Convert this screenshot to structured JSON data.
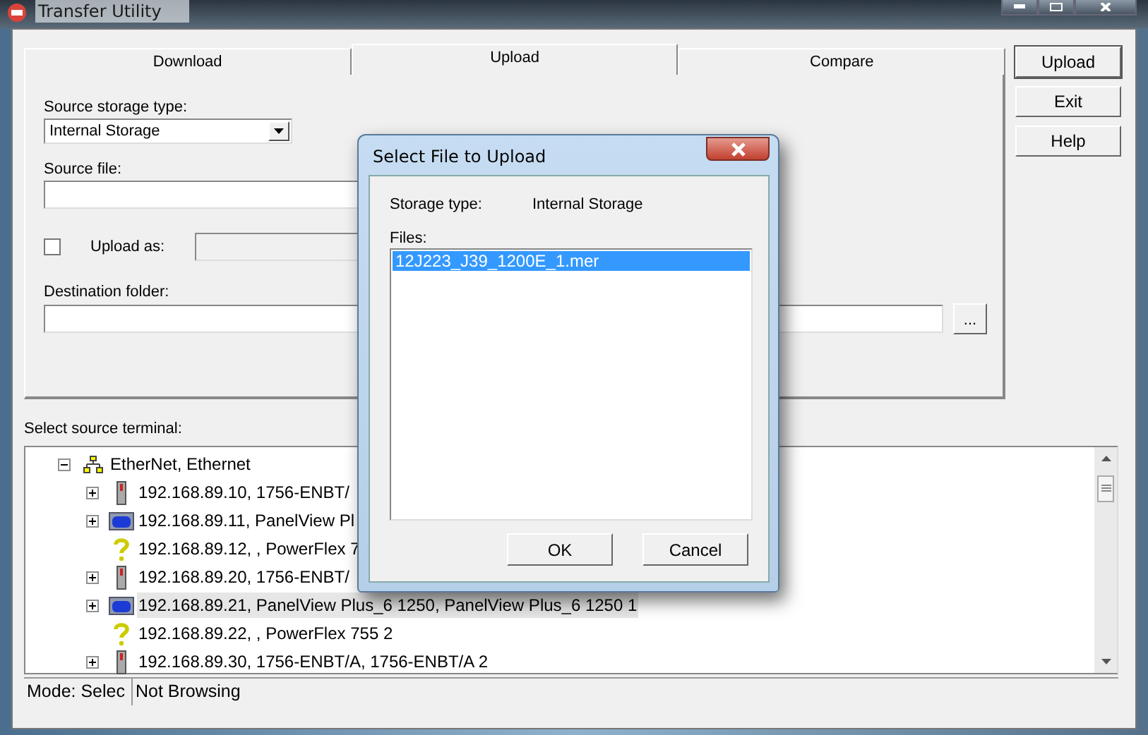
{
  "window": {
    "title": "Transfer Utility"
  },
  "tabs": [
    {
      "label": "Download",
      "selected": false
    },
    {
      "label": "Upload",
      "selected": true
    },
    {
      "label": "Compare",
      "selected": false
    }
  ],
  "upload_panel": {
    "source_storage_label": "Source storage type:",
    "source_storage_value": "Internal Storage",
    "source_file_label": "Source file:",
    "upload_as_checked": false,
    "upload_as_label": "Upload as:",
    "destination_label": "Destination folder:",
    "browse_button": "..."
  },
  "side_buttons": [
    "Upload",
    "Exit",
    "Help"
  ],
  "terminal_label": "Select source terminal:",
  "tree": [
    {
      "label": "EtherNet, Ethernet",
      "kind": "network",
      "expanded": true,
      "selected": false,
      "children": [
        {
          "label": "192.168.89.10, 1756-ENBT/",
          "kind": "module",
          "expanded": false,
          "selected": false
        },
        {
          "label": "192.168.89.11, PanelView Pl",
          "kind": "panel",
          "expanded": false,
          "selected": false
        },
        {
          "label": "192.168.89.12, , PowerFlex 7",
          "kind": "unknown",
          "selected": false
        },
        {
          "label": "192.168.89.20, 1756-ENBT/",
          "kind": "module",
          "expanded": false,
          "selected": false
        },
        {
          "label": "192.168.89.21, PanelView Plus_6 1250, PanelView Plus_6 1250 1",
          "kind": "panel",
          "expanded": false,
          "selected": true
        },
        {
          "label": "192.168.89.22, , PowerFlex 755 2",
          "kind": "unknown",
          "selected": false
        },
        {
          "label": "192.168.89.30, 1756-ENBT/A, 1756-ENBT/A 2",
          "kind": "module",
          "expanded": false,
          "selected": false
        }
      ]
    }
  ],
  "status_bar": [
    "Mode: Selec",
    "Not Browsing"
  ],
  "dialog": {
    "title": "Select File to Upload",
    "storage_label": "Storage type:",
    "storage_value": "Internal Storage",
    "files_label": "Files:",
    "files": [
      {
        "name": "12J223_J39_1200E_1.mer",
        "selected": true
      }
    ],
    "buttons": [
      "OK",
      "Cancel"
    ]
  }
}
